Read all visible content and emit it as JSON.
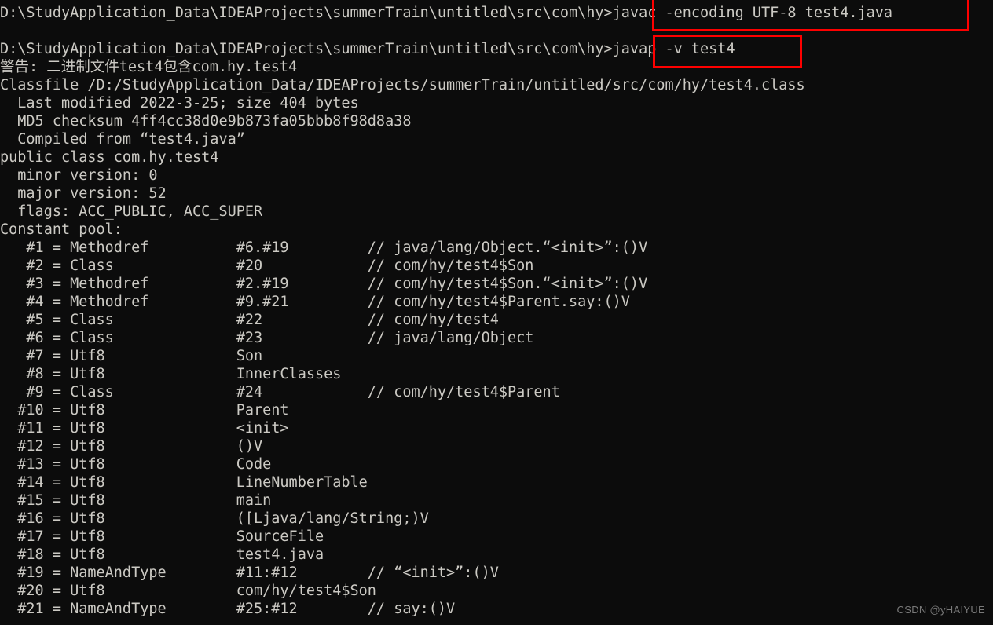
{
  "terminal": {
    "background_color": "#0c0c0c",
    "text_color": "#cccac4",
    "annotation_color": "#fe0000",
    "lines": [
      "D:\\StudyApplication_Data\\IDEAProjects\\summerTrain\\untitled\\src\\com\\hy>javac -encoding UTF-8 test4.java",
      "",
      "D:\\StudyApplication_Data\\IDEAProjects\\summerTrain\\untitled\\src\\com\\hy>javap -v test4",
      "警告: 二进制文件test4包含com.hy.test4",
      "Classfile /D:/StudyApplication_Data/IDEAProjects/summerTrain/untitled/src/com/hy/test4.class",
      "  Last modified 2022-3-25; size 404 bytes",
      "  MD5 checksum 4ff4cc38d0e9b873fa05bbb8f98d8a38",
      "  Compiled from “test4.java”",
      "public class com.hy.test4",
      "  minor version: 0",
      "  major version: 52",
      "  flags: ACC_PUBLIC, ACC_SUPER",
      "Constant pool:",
      "   #1 = Methodref          #6.#19         // java/lang/Object.“<init>”:()V",
      "   #2 = Class              #20            // com/hy/test4$Son",
      "   #3 = Methodref          #2.#19         // com/hy/test4$Son.“<init>”:()V",
      "   #4 = Methodref          #9.#21         // com/hy/test4$Parent.say:()V",
      "   #5 = Class              #22            // com/hy/test4",
      "   #6 = Class              #23            // java/lang/Object",
      "   #7 = Utf8               Son",
      "   #8 = Utf8               InnerClasses",
      "   #9 = Class              #24            // com/hy/test4$Parent",
      "  #10 = Utf8               Parent",
      "  #11 = Utf8               <init>",
      "  #12 = Utf8               ()V",
      "  #13 = Utf8               Code",
      "  #14 = Utf8               LineNumberTable",
      "  #15 = Utf8               main",
      "  #16 = Utf8               ([Ljava/lang/String;)V",
      "  #17 = Utf8               SourceFile",
      "  #18 = Utf8               test4.java",
      "  #19 = NameAndType        #11:#12        // “<init>”:()V",
      "  #20 = Utf8               com/hy/test4$Son",
      "  #21 = NameAndType        #25:#12        // say:()V"
    ]
  },
  "commands": {
    "javac": "javac -encoding UTF-8 test4.java",
    "javap": "javap -v test4"
  },
  "classfile_info": {
    "path": "/D:/StudyApplication_Data/IDEAProjects/summerTrain/untitled/src/com/hy/test4.class",
    "last_modified": "2022-3-25",
    "size": "404 bytes",
    "md5_checksum": "4ff4cc38d0e9b873fa05bbb8f98d8a38",
    "compiled_from": "test4.java",
    "class_declaration": "public class com.hy.test4",
    "minor_version": "0",
    "major_version": "52",
    "flags": "ACC_PUBLIC, ACC_SUPER"
  },
  "watermark": {
    "text": "CSDN @yHAIYUE"
  }
}
